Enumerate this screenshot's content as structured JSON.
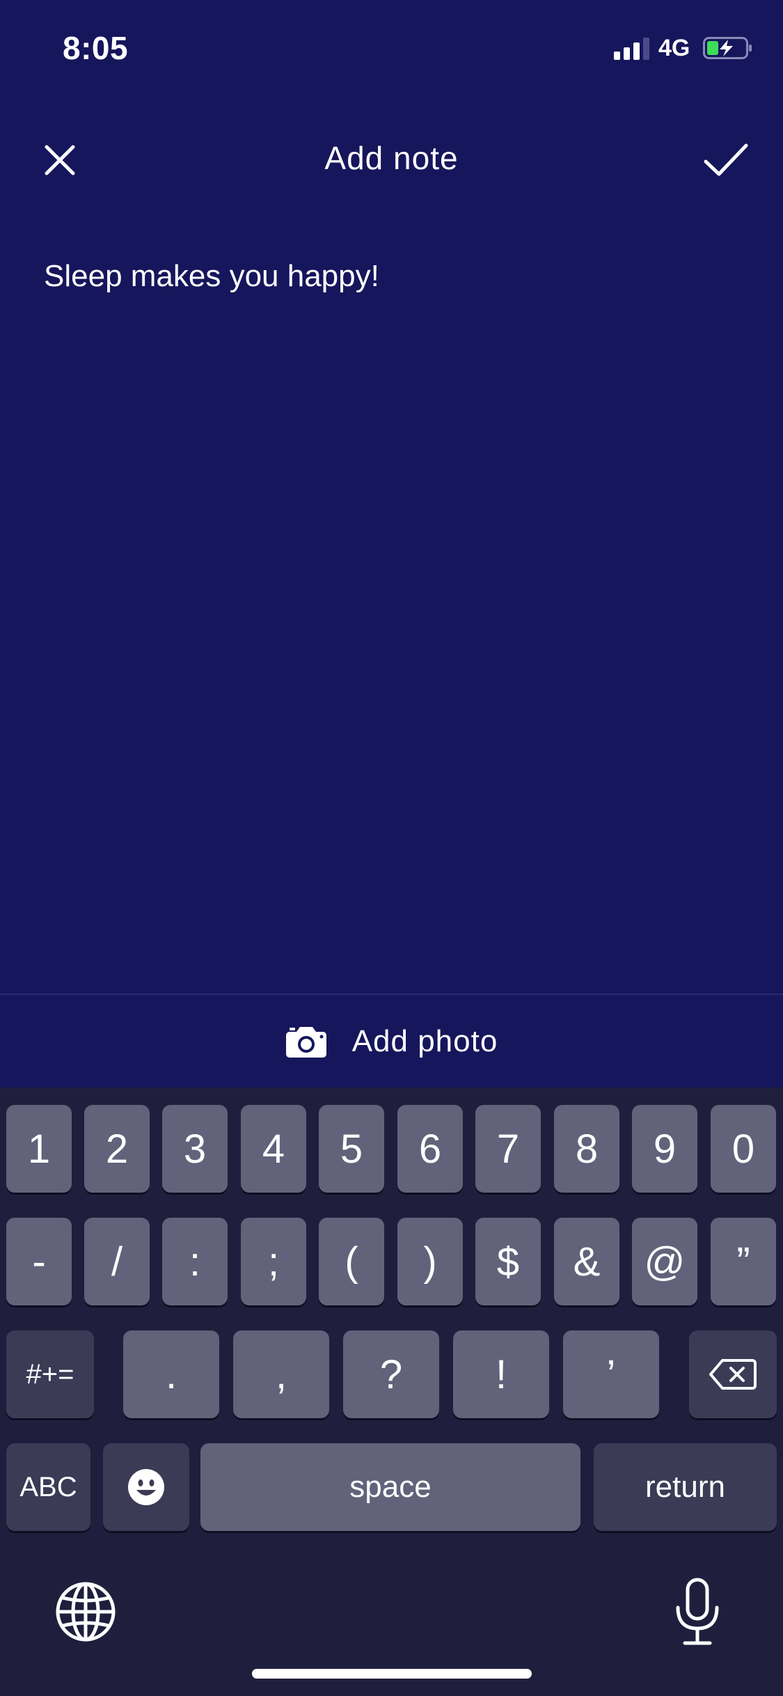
{
  "status_bar": {
    "time": "8:05",
    "network": "4G"
  },
  "nav": {
    "title": "Add note"
  },
  "note": {
    "text": "Sleep makes you happy!"
  },
  "add_photo": {
    "label": "Add photo"
  },
  "keyboard": {
    "row1": [
      "1",
      "2",
      "3",
      "4",
      "5",
      "6",
      "7",
      "8",
      "9",
      "0"
    ],
    "row2": [
      "-",
      "/",
      ":",
      ";",
      "(",
      ")",
      "$",
      "&",
      "@",
      "”"
    ],
    "row3": {
      "symbols_key": "#+=",
      "keys": [
        ".",
        ",",
        "?",
        "!",
        "’"
      ]
    },
    "row4": {
      "abc": "ABC",
      "space": "space",
      "return": "return"
    }
  },
  "colors": {
    "background": "#16165c",
    "keyboard_bg": "#1f1f3d",
    "key": "#62627a",
    "key_dark": "#3b3b56"
  }
}
